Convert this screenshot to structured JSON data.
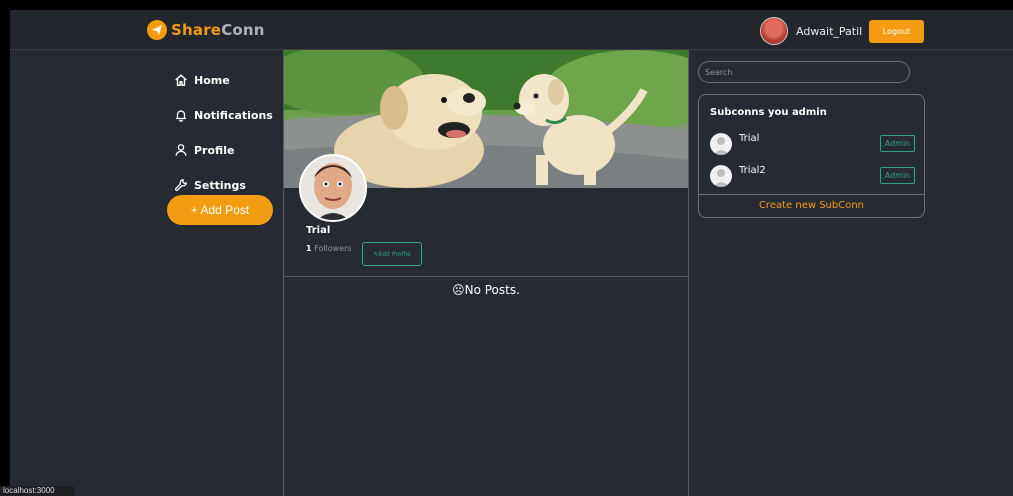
{
  "header": {
    "brand_share": "Share",
    "brand_conn": "Conn",
    "username": "Adwait_Patil",
    "logout_label": "Logout"
  },
  "sidebar": {
    "items": [
      {
        "label": "Home",
        "icon": "home-icon"
      },
      {
        "label": "Notifications",
        "icon": "bell-icon"
      },
      {
        "label": "Profile",
        "icon": "user-icon"
      },
      {
        "label": "Settings",
        "icon": "wrench-icon"
      }
    ],
    "add_post_label": "+ Add Post"
  },
  "profile": {
    "name": "Trial",
    "followers_count": "1",
    "followers_label": "Followers",
    "edit_profile_label": "✎Edit Profile",
    "no_posts": "☹No Posts."
  },
  "right": {
    "search_placeholder": "Search",
    "panel_title": "Subconns you admin",
    "subconns": [
      {
        "name": "Trial",
        "badge": "Admin"
      },
      {
        "name": "Trial2",
        "badge": "Admin"
      }
    ],
    "create_label": "Create new SubConn"
  },
  "status_bar": "localhost:3000",
  "colors": {
    "accent": "#f39c12",
    "teal": "#2ea48a",
    "background": "#262a33"
  }
}
